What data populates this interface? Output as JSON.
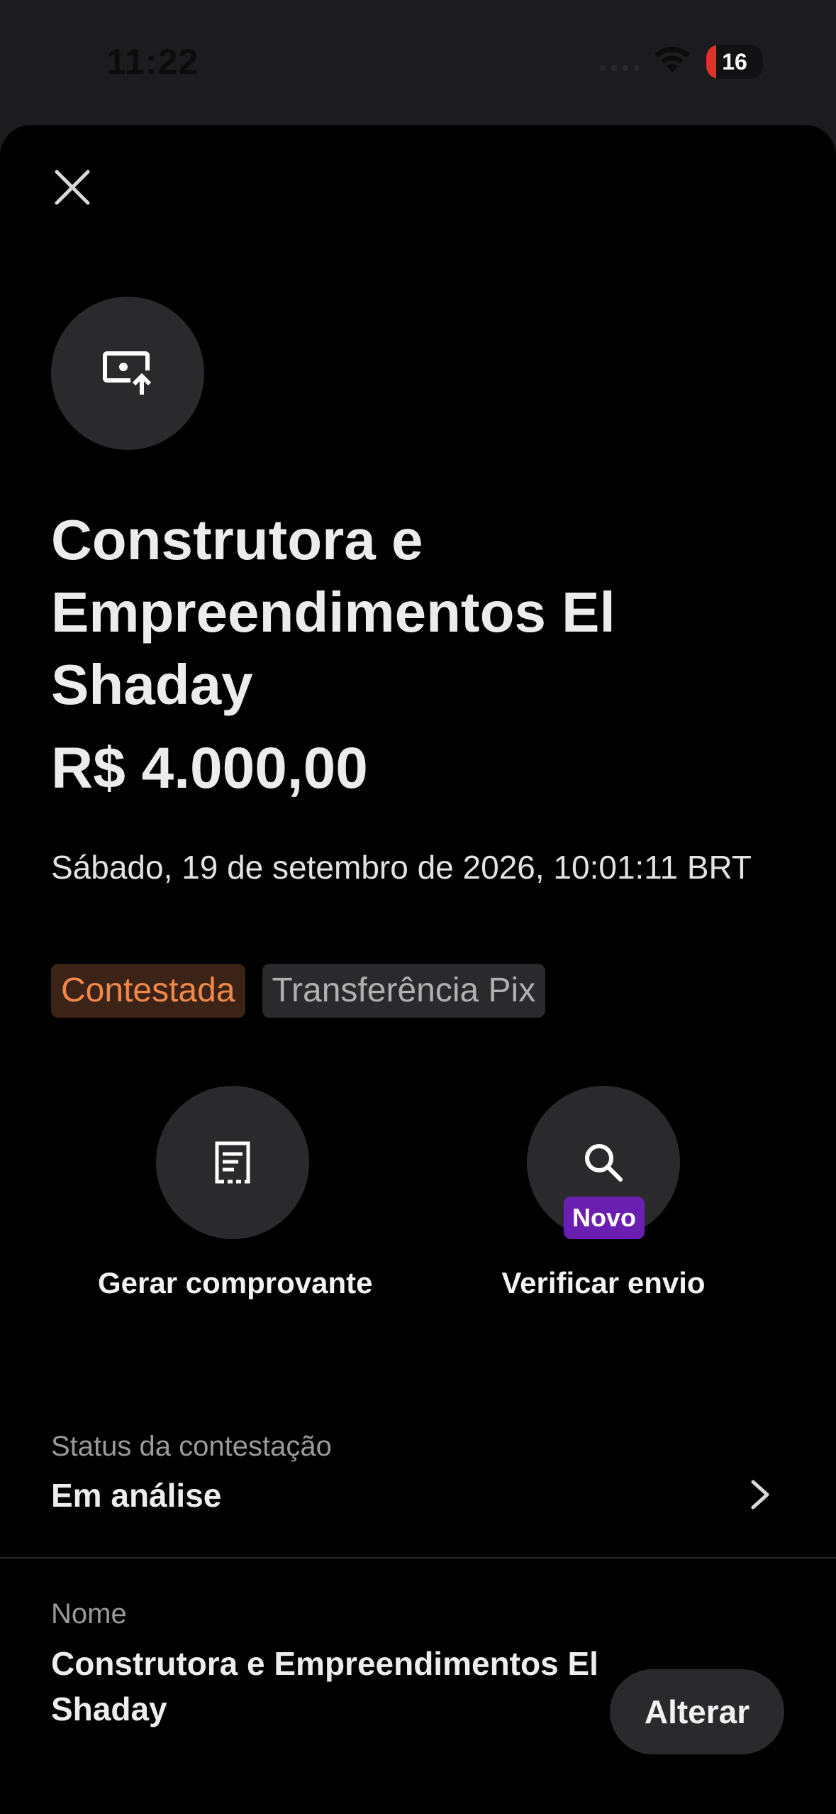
{
  "status_bar": {
    "time": "11:22",
    "battery": "16",
    "battery_level": 0.16,
    "icons": [
      "wifi-icon",
      "battery-icon"
    ]
  },
  "header": {
    "close_icon": "close-icon"
  },
  "transaction": {
    "avatar_icon": "money-transfer-upload-icon",
    "title": "Construtora e Empreendimentos El Shaday",
    "amount": "R$ 4.000,00",
    "datetime": "Sábado, 19 de setembro de 2026, 10:01:11 BRT",
    "tags": [
      {
        "label": "Contestada",
        "color": "#f08848"
      },
      {
        "label": "Transferência Pix",
        "color": "#b0b0b0"
      }
    ]
  },
  "actions": [
    {
      "label": "Gerar comprovante",
      "icon": "receipt-icon"
    },
    {
      "label": "Verificar envio",
      "icon": "search-icon",
      "badge": "Novo",
      "badge_color": "#6a1fb0"
    }
  ],
  "dispute_status": {
    "label": "Status da contestação",
    "value": "Em análise",
    "icon": "chevron-right-icon"
  },
  "name_section": {
    "label": "Nome",
    "value": "Construtora e Empreendimentos El Shaday",
    "button": "Alterar"
  },
  "colors": {
    "background": "#000000",
    "surface": "#2a2a2c",
    "accent_orange": "#f08848",
    "accent_purple": "#6a1fb0"
  }
}
